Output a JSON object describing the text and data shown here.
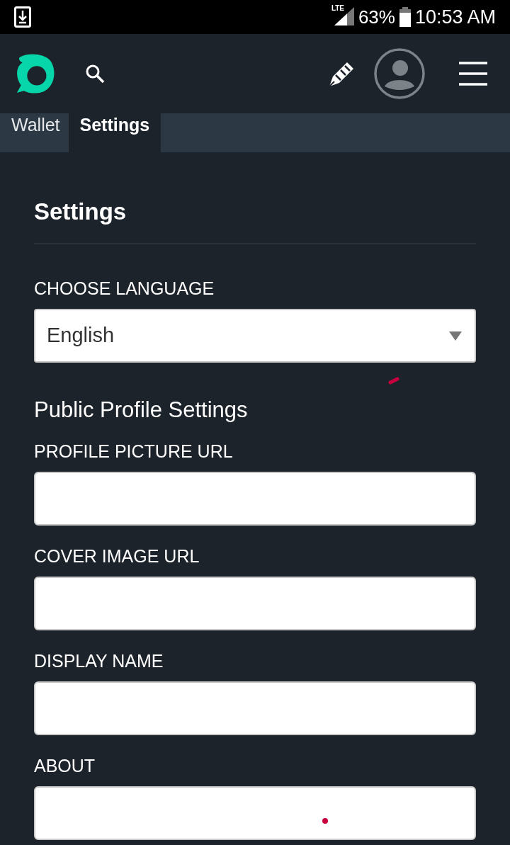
{
  "status_bar": {
    "network_type": "LTE",
    "battery": "63%",
    "time": "10:53 AM"
  },
  "tabs": [
    {
      "label": "Wallet",
      "selected": false
    },
    {
      "label": "Settings",
      "selected": true
    }
  ],
  "settings": {
    "title": "Settings",
    "language": {
      "label": "CHOOSE LANGUAGE",
      "value": "English"
    },
    "section_title": "Public Profile Settings",
    "fields": [
      {
        "label": "PROFILE PICTURE URL"
      },
      {
        "label": "COVER IMAGE URL"
      },
      {
        "label": "DISPLAY NAME"
      },
      {
        "label": "ABOUT"
      }
    ]
  }
}
